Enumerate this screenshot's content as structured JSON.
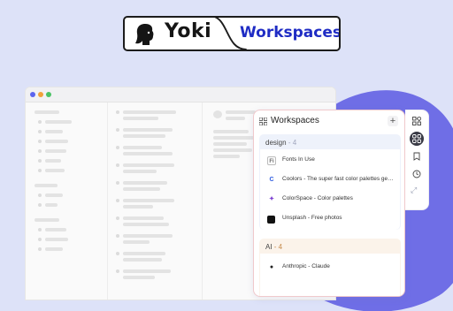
{
  "badge": {
    "brand": "Yoki",
    "product": "Workspaces"
  },
  "panel": {
    "title": "Workspaces",
    "add_label": "+",
    "groups": [
      {
        "name": "design",
        "count_text": "- 4",
        "items": [
          {
            "label": "Fonts In Use",
            "icon": "fonts-in-use-favicon"
          },
          {
            "label": "Coolors - The super fast color palettes generator!",
            "icon": "coolors-favicon"
          },
          {
            "label": "ColorSpace - Color palettes",
            "icon": "colorspace-favicon"
          },
          {
            "label": "Unsplash - Free photos",
            "icon": "unsplash-favicon"
          }
        ]
      },
      {
        "name": "AI",
        "count_text": "- 4",
        "items": [
          {
            "label": "Anthropic - Claude",
            "icon": "anthropic-favicon"
          }
        ]
      }
    ]
  },
  "rail_icons": [
    "workspaces-grid-icon",
    "group-icon",
    "bookmark-icon",
    "history-icon"
  ],
  "colors": {
    "accent": "#1f2cc4",
    "blob": "#6f6ee6",
    "background": "#dde2f8"
  }
}
